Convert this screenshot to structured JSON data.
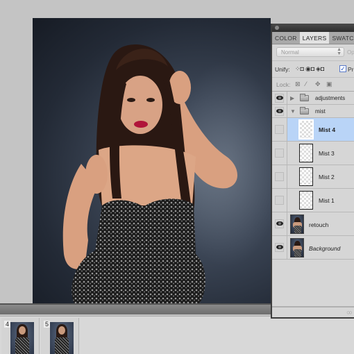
{
  "panel": {
    "tabs": [
      {
        "label": "COLOR",
        "active": false
      },
      {
        "label": "LAYERS",
        "active": true
      },
      {
        "label": "SWATCHES",
        "active": false
      }
    ],
    "blend_mode": "Normal",
    "opacity_label": "Op",
    "unify_label": "Unify:",
    "propagate_label": "Pro",
    "propagate_checked": true,
    "lock_label": "Lock:",
    "layers": [
      {
        "type": "group",
        "name": "adjustments",
        "visible": true,
        "expanded": false
      },
      {
        "type": "group",
        "name": "mist",
        "visible": true,
        "expanded": true
      },
      {
        "type": "transparent",
        "name": "Mist 4",
        "visible": false,
        "selected": true
      },
      {
        "type": "transparent",
        "name": "Mist 3",
        "visible": false,
        "selected": false
      },
      {
        "type": "transparent",
        "name": "Mist 2",
        "visible": false,
        "selected": false
      },
      {
        "type": "transparent",
        "name": "Mist 1",
        "visible": false,
        "selected": false
      },
      {
        "type": "photo",
        "name": "retouch",
        "visible": true,
        "italic": false
      },
      {
        "type": "photo",
        "name": "Background",
        "visible": true,
        "italic": true
      }
    ],
    "footer_icon": "link-layers-icon"
  },
  "filmstrip": {
    "frames": [
      {
        "number": "4"
      },
      {
        "number": "5"
      }
    ]
  },
  "colors": {
    "selection": "#b9d4f7",
    "workspace": "#c4c4c4",
    "panel_bg": "#d6d6d6"
  }
}
